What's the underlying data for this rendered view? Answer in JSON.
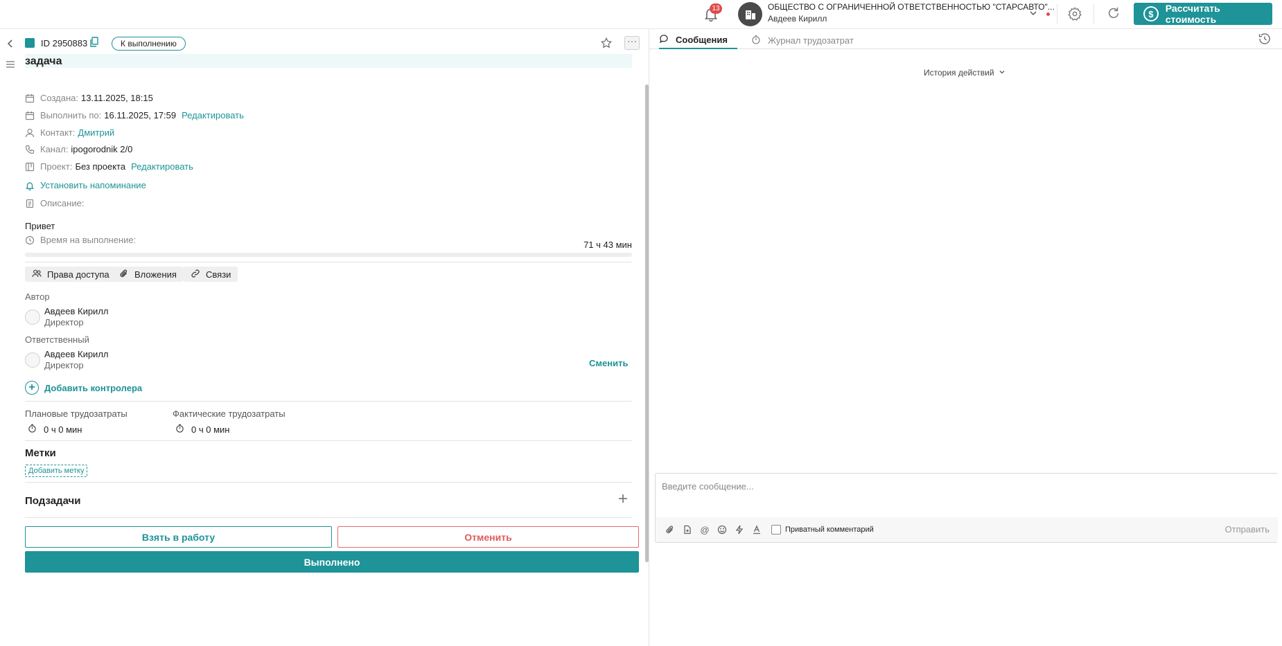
{
  "header": {
    "notifications_count": "13",
    "company_name": "ОБЩЕСТВО С ОГРАНИЧЕННОЙ ОТВЕТСТВЕННОСТЬЮ \"СТАРСАВТО\"...",
    "user_name": "Авдеев Кирилл",
    "calc_button": "Рассчитать стоимость",
    "accent_color": "#1e9398"
  },
  "task": {
    "id_label": "ID 2950883",
    "status": "К выполнению",
    "title": "задача",
    "created_label": "Создана:",
    "created_value": "13.11.2025, 18:15",
    "due_label": "Выполнить по:",
    "due_value": "16.11.2025, 17:59",
    "edit_link": "Редактировать",
    "contact_label": "Контакт:",
    "contact_value": "Дмитрий",
    "channel_label": "Канал:",
    "channel_value": "ipogorodnik 2/0",
    "project_label": "Проект:",
    "project_value": "Без проекта",
    "reminder_link": "Установить напоминание",
    "description_label": "Описание:",
    "description_text": "Привет",
    "time_label": "Время на выполнение:",
    "time_value": "71 ч 43 мин",
    "time_progress": 0
  },
  "chips": {
    "access": "Права доступа",
    "attachments": "Вложения",
    "links": "Связи"
  },
  "people": {
    "author_label": "Автор",
    "author_name": "Авдеев Кирилл",
    "author_role": "Директор",
    "responsible_label": "Ответственный",
    "responsible_name": "Авдеев Кирилл",
    "responsible_role": "Директор",
    "change_link": "Сменить",
    "add_controller": "Добавить контролера"
  },
  "effort": {
    "planned_label": "Плановые трудозатраты",
    "planned_value": "0 ч 0 мин",
    "actual_label": "Фактические трудозатраты",
    "actual_value": "0 ч 0 мин"
  },
  "tags": {
    "title": "Метки",
    "add_tag": "Добавить метку"
  },
  "subtasks": {
    "title": "Подзадачи"
  },
  "actions": {
    "take": "Взять в работу",
    "cancel": "Отменить",
    "done": "Выполнено"
  },
  "right": {
    "tab_messages": "Сообщения",
    "tab_journal": "Журнал трудозатрат",
    "history": "История действий",
    "composer_placeholder": "Введите сообщение...",
    "private_comment": "Приватный комментарий",
    "send": "Отправить"
  }
}
